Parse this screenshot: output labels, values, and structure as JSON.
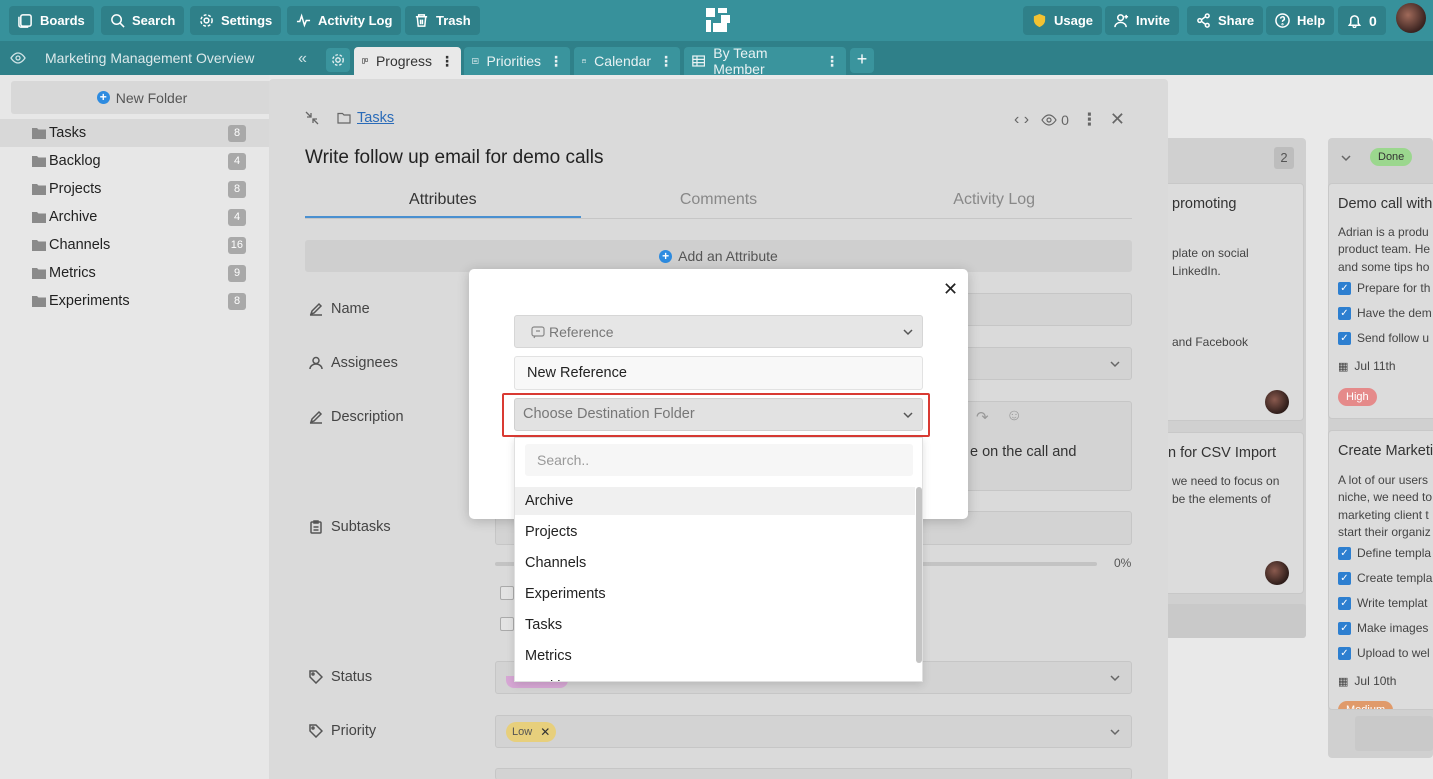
{
  "topbar": {
    "boards": "Boards",
    "search": "Search",
    "settings": "Settings",
    "activity_log": "Activity Log",
    "trash": "Trash",
    "usage": "Usage",
    "invite": "Invite",
    "share": "Share",
    "help": "Help",
    "notifications": "0"
  },
  "tabbar": {
    "board_title": "Marketing Management Overview",
    "views": [
      {
        "label": "Progress"
      },
      {
        "label": "Priorities"
      },
      {
        "label": "Calendar"
      },
      {
        "label": "By Team Member"
      }
    ]
  },
  "sidebar": {
    "new_folder": "New Folder",
    "folders": [
      {
        "name": "Tasks",
        "count": "8"
      },
      {
        "name": "Backlog",
        "count": "4"
      },
      {
        "name": "Projects",
        "count": "8"
      },
      {
        "name": "Archive",
        "count": "4"
      },
      {
        "name": "Channels",
        "count": "16"
      },
      {
        "name": "Metrics",
        "count": "9"
      },
      {
        "name": "Experiments",
        "count": "8"
      }
    ]
  },
  "board": {
    "col1_count": "2",
    "col2_status": "Done",
    "card1": {
      "title": "promoting",
      "line1": "plate on social",
      "line2": "LinkedIn.",
      "line3": "and Facebook"
    },
    "card2": {
      "title": "n for CSV Import",
      "line1": "we need to focus on",
      "line2": "be the elements of"
    },
    "card3": {
      "title": "Demo call with",
      "line1": "Adrian is a produ",
      "line2": "product team. He",
      "line3": "and some tips ho",
      "checks": [
        "Prepare for th",
        "Have the dem",
        "Send follow u"
      ],
      "date": "Jul 11th",
      "priority": "High"
    },
    "card4": {
      "title": "Create Marketi",
      "line1": "A lot of our users",
      "line2": "niche, we need to",
      "line3": "marketing client t",
      "line4": "start their organiz",
      "checks": [
        "Define templa",
        "Create templa",
        "Write templat",
        "Make images",
        "Upload to wel"
      ],
      "date": "Jul 10th",
      "priority": "Medium"
    }
  },
  "task": {
    "breadcrumb": "Tasks",
    "title": "Write follow up email for demo calls",
    "watchers": "0",
    "tabs": [
      "Attributes",
      "Comments",
      "Activity Log"
    ],
    "add_attribute": "Add an Attribute",
    "labels": {
      "name": "Name",
      "assignees": "Assignees",
      "description": "Description",
      "subtasks": "Subtasks",
      "status": "Status",
      "priority": "Priority"
    },
    "description_fragment": "e on the call and",
    "subtask_progress": "0%",
    "priority_tag": "Low"
  },
  "reference_dialog": {
    "type_select": "Reference",
    "name_value": "New Reference",
    "destination_placeholder": "Choose Destination Folder",
    "search_placeholder": "Search..",
    "options": [
      "Archive",
      "Projects",
      "Channels",
      "Experiments",
      "Tasks",
      "Metrics",
      "Backlog"
    ]
  },
  "colors": {
    "topbar": "#37919b",
    "accent_blue": "#2d8be0",
    "highlight_red": "#d93a33"
  }
}
